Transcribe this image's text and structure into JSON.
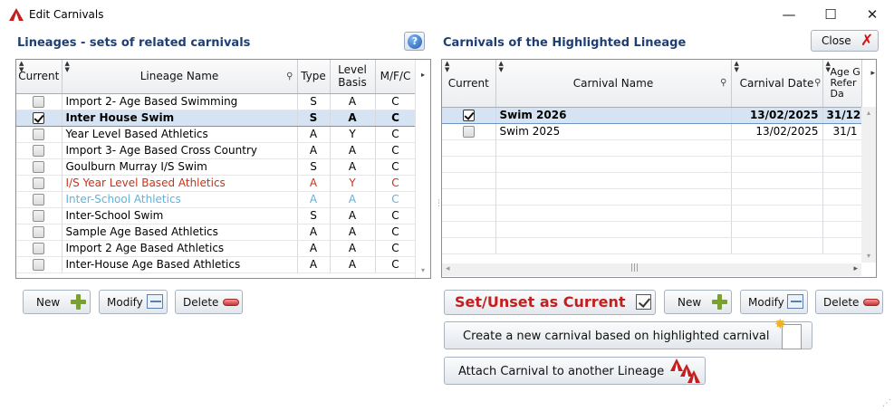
{
  "window": {
    "title": "Edit Carnivals",
    "controls": {
      "minimize": "—",
      "maximize": "☐",
      "close": "✕"
    }
  },
  "left": {
    "title": "Lineages - sets of related carnivals",
    "help_icon_label": "?",
    "columns": [
      "Current",
      "Lineage Name",
      "Type",
      "Level Basis",
      "M/F/C"
    ],
    "rows": [
      {
        "current": false,
        "name": "Import 2- Age Based  Swimming",
        "type": "S",
        "level": "A",
        "mfc": "C",
        "style": "normal"
      },
      {
        "current": true,
        "name": "Inter House Swim",
        "type": "S",
        "level": "A",
        "mfc": "C",
        "style": "selected"
      },
      {
        "current": false,
        "name": "Year Level Based  Athletics",
        "type": "A",
        "level": "Y",
        "mfc": "C",
        "style": "normal"
      },
      {
        "current": false,
        "name": "Import 3- Age Based  Cross Country",
        "type": "A",
        "level": "A",
        "mfc": "C",
        "style": "normal"
      },
      {
        "current": false,
        "name": "Goulburn Murray I/S Swim",
        "type": "S",
        "level": "A",
        "mfc": "C",
        "style": "normal"
      },
      {
        "current": false,
        "name": "I/S Year Level Based  Athletics",
        "type": "A",
        "level": "Y",
        "mfc": "C",
        "style": "red"
      },
      {
        "current": false,
        "name": "Inter-School Athletics",
        "type": "A",
        "level": "A",
        "mfc": "C",
        "style": "blue"
      },
      {
        "current": false,
        "name": "Inter-School Swim",
        "type": "S",
        "level": "A",
        "mfc": "C",
        "style": "normal"
      },
      {
        "current": false,
        "name": "Sample Age Based  Athletics",
        "type": "A",
        "level": "A",
        "mfc": "C",
        "style": "normal"
      },
      {
        "current": false,
        "name": "Import 2 Age Based  Athletics",
        "type": "A",
        "level": "A",
        "mfc": "C",
        "style": "normal"
      },
      {
        "current": false,
        "name": "Inter-House Age Based  Athletics",
        "type": "A",
        "level": "A",
        "mfc": "C",
        "style": "normal"
      }
    ],
    "buttons": {
      "new": "New",
      "modify": "Modify",
      "delete": "Delete"
    }
  },
  "right": {
    "title": "Carnivals of the Highlighted Lineage",
    "close_label": "Close",
    "columns": [
      "Current",
      "Carnival Name",
      "Carnival Date",
      "Age G Refer Da"
    ],
    "rows": [
      {
        "current": true,
        "name": "Swim 2026",
        "date": "13/02/2025",
        "ref": "31/12",
        "style": "selected"
      },
      {
        "current": false,
        "name": "Swim 2025",
        "date": "13/02/2025",
        "ref": "31/1",
        "style": "normal"
      }
    ],
    "buttons": {
      "set_current": "Set/Unset as Current",
      "new": "New",
      "modify": "Modify",
      "delete": "Delete",
      "create_based": "Create a new carnival based on highlighted carnival",
      "attach": "Attach Carnival to another Lineage"
    }
  },
  "colors": {
    "heading": "#1f3e72",
    "selected_row": "#d5e3f3",
    "red_row": "#c8321b",
    "blue_row": "#5fb3e0",
    "set_current": "#c41f1f"
  }
}
